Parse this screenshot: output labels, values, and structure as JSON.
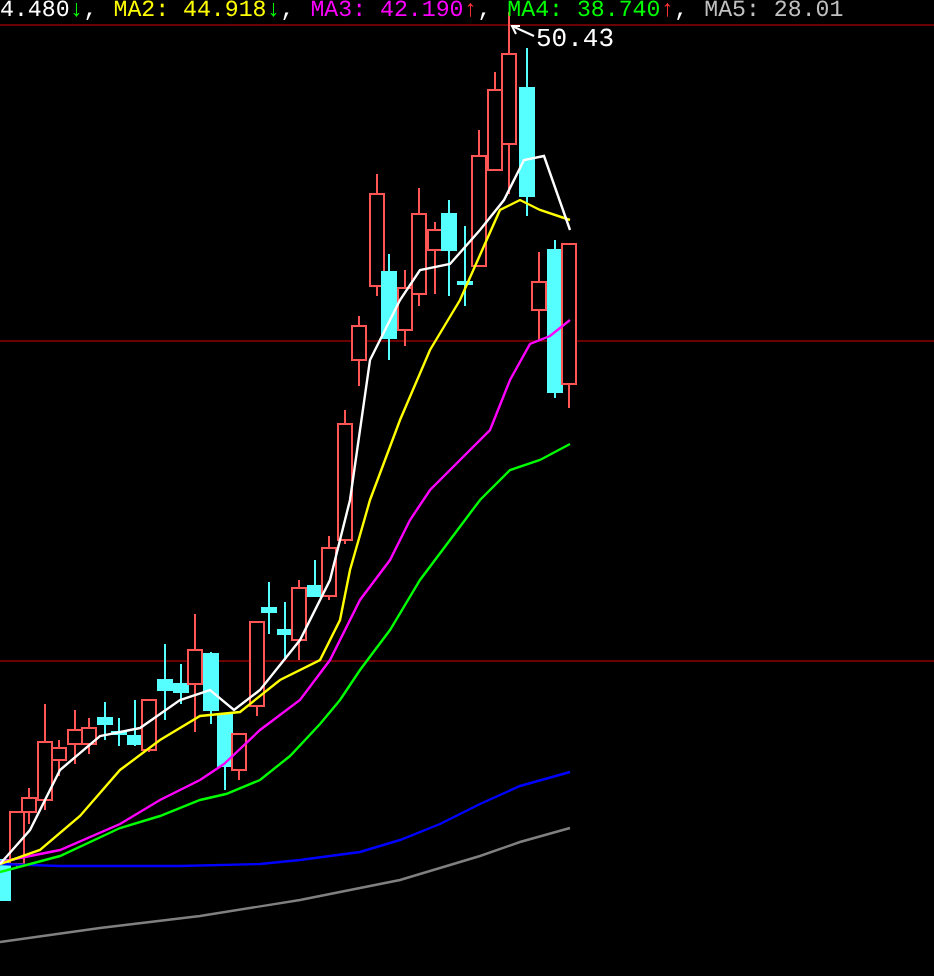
{
  "legend": [
    {
      "label": "4.480",
      "arrow": "↓",
      "rising": false,
      "color": "#ffffff",
      "sep": ","
    },
    {
      "label": "MA2: 44.918",
      "arrow": "↓",
      "rising": false,
      "color": "#ffff00",
      "sep": ","
    },
    {
      "label": "MA3: 42.190",
      "arrow": "↑",
      "rising": true,
      "color": "#ff00ff",
      "sep": ","
    },
    {
      "label": "MA4: 38.740",
      "arrow": "↑",
      "rising": true,
      "color": "#00ff00",
      "sep": ","
    },
    {
      "label": "MA5: 28.01",
      "color": "#c0c0c0"
    }
  ],
  "chart": {
    "kind": "picture",
    "max_label": "50.43"
  }
}
